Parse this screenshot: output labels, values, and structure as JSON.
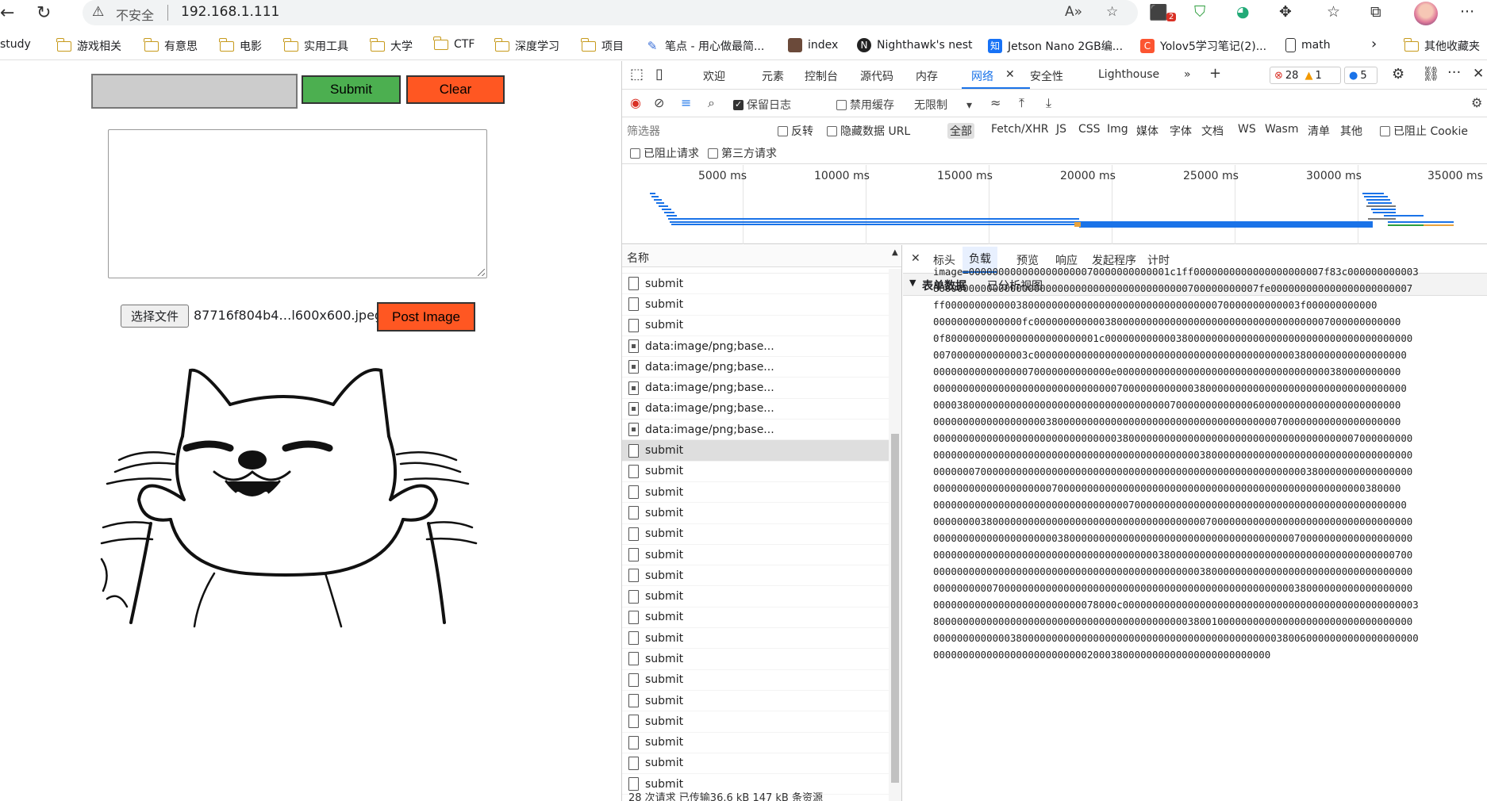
{
  "browser": {
    "not_secure": "不安全",
    "url": "192.168.1.111",
    "ext_badge": "2"
  },
  "bookmarks": [
    {
      "label": "study",
      "icon": "folder-icon"
    },
    {
      "label": "游戏相关",
      "icon": "folder-icon"
    },
    {
      "label": "有意思",
      "icon": "folder-icon"
    },
    {
      "label": "电影",
      "icon": "folder-icon"
    },
    {
      "label": "实用工具",
      "icon": "folder-icon"
    },
    {
      "label": "大学",
      "icon": "folder-icon"
    },
    {
      "label": "CTF",
      "icon": "folder-icon"
    },
    {
      "label": "深度学习",
      "icon": "folder-icon"
    },
    {
      "label": "项目",
      "icon": "folder-icon"
    },
    {
      "label": "笔点 - 用心做最简...",
      "icon": "pen-icon"
    },
    {
      "label": "index",
      "icon": "image-icon"
    },
    {
      "label": "Nighthawk's nest",
      "icon": "n-logo-icon"
    },
    {
      "label": "Jetson Nano 2GB编...",
      "icon": "zhihu-icon"
    },
    {
      "label": "Yolov5学习笔记(2)...",
      "icon": "csdn-icon"
    },
    {
      "label": "math",
      "icon": "page-icon"
    }
  ],
  "bookmarks_other": "其他收藏夹",
  "page": {
    "submit_label": "Submit",
    "clear_label": "Clear",
    "choose_file_label": "选择文件",
    "file_name": "87716f804b4…l600x600.jpeg",
    "post_image_label": "Post Image"
  },
  "devtools": {
    "tabs": [
      "欢迎",
      "元素",
      "控制台",
      "源代码",
      "内存",
      "网络",
      "安全性",
      "Lighthouse"
    ],
    "active_tab": "网络",
    "error_count": "28",
    "warning_count": "1",
    "message_count": "5",
    "preserve_log": "保留日志",
    "disable_cache": "禁用缓存",
    "throttle": "无限制",
    "filter_placeholder": "筛选器",
    "invert": "反转",
    "hide_data_urls": "隐藏数据 URL",
    "filter_types": [
      "全部",
      "Fetch/XHR",
      "JS",
      "CSS",
      "Img",
      "媒体",
      "字体",
      "文档",
      "WS",
      "Wasm",
      "清单",
      "其他"
    ],
    "blocked_cookies": "已阻止 Cookie",
    "blocked_requests": "已阻止请求",
    "third_party": "第三方请求",
    "timeline_ticks": [
      "5000 ms",
      "10000 ms",
      "15000 ms",
      "20000 ms",
      "25000 ms",
      "30000 ms",
      "35000 ms"
    ],
    "name_header": "名称",
    "requests": [
      {
        "name": "submit",
        "type": "doc"
      },
      {
        "name": "submit",
        "type": "doc"
      },
      {
        "name": "submit",
        "type": "doc"
      },
      {
        "name": "data:image/png;base...",
        "type": "img"
      },
      {
        "name": "data:image/png;base...",
        "type": "img"
      },
      {
        "name": "data:image/png;base...",
        "type": "img"
      },
      {
        "name": "data:image/png;base...",
        "type": "img"
      },
      {
        "name": "data:image/png;base...",
        "type": "img"
      },
      {
        "name": "submit",
        "type": "doc",
        "selected": true
      },
      {
        "name": "submit",
        "type": "doc"
      },
      {
        "name": "submit",
        "type": "doc"
      },
      {
        "name": "submit",
        "type": "doc"
      },
      {
        "name": "submit",
        "type": "doc"
      },
      {
        "name": "submit",
        "type": "doc"
      },
      {
        "name": "submit",
        "type": "doc"
      },
      {
        "name": "submit",
        "type": "doc"
      },
      {
        "name": "submit",
        "type": "doc"
      },
      {
        "name": "submit",
        "type": "doc"
      },
      {
        "name": "submit",
        "type": "doc"
      },
      {
        "name": "submit",
        "type": "doc"
      },
      {
        "name": "submit",
        "type": "doc"
      },
      {
        "name": "submit",
        "type": "doc"
      },
      {
        "name": "submit",
        "type": "doc"
      },
      {
        "name": "submit",
        "type": "doc"
      },
      {
        "name": "submit",
        "type": "doc"
      }
    ],
    "detail_tabs": [
      "标头",
      "负载",
      "预览",
      "响应",
      "发起程序",
      "计时"
    ],
    "active_detail_tab": "负载",
    "form_data_label": "表单数据",
    "parsed_view": "已分析视图",
    "payload_lines": [
      "image=0000000000000000000070000000000001c1ff0000000000000000000007f83c000000000003",
      "8000000000000000000000000000000000000000000700000000007fe000000000000000000000007",
      "ff000000000000380000000000000000000000000000000070000000000003f000000000000",
      "000000000000000fc00000000000038000000000000000000000000000000000007000000000000",
      "0f80000000000000000000000001c0000000000003800000000000000000000000000000000000000",
      "0070000000000003c000000000000000000000000000000000000000000003800000000000000000",
      "000000000000000070000000000000e000000000000000000000000000000000000380000000000",
      "00000000000000000000000000000007000000000000380000000000000000000000000000000000",
      "0000380000000000000000000000000000000000700000000000006000000000000000000000000",
      "0000000000000000000380000000000000000000000000000000000000700000000000000000000",
      "000000000000000000000000000000038000000000000000000000000000000000000007000000000",
      "000000000000000000000000000000000000000000000380000000000000000000000000000000000",
      "000000070000000000000000000000000000000000000000000000000000000380000000000000000",
      "0000000000000000000070000000000000000000000000000000000000000000000000000380000",
      "00000000000000000000000000000000070000000000000000000000000000000000000000000000",
      "000000003800000000000000000000000000000000000070000000000000000000000000000000000",
      "000000000000000000000380000000000000000000000000000000000000070000000000000000000",
      "000000000000000000000000000000000000003800000000000000000000000000000000000000700",
      "000000000000000000000000000000000000000000000380000000000000000000000000000000000",
      "000000000070000000000000000000000000000000000000000000000000038000000000000000000",
      "0000000000000000000000000078000c00000000000000000000000000000000000000000000000003",
      "800000000000000000000000000000000000000000038001000000000000000000000000000000000",
      "0000000000000380000000000000000000000000000000000000000000380060000000000000000000",
      "000000000000000000000000002000380000000000000000000000000"
    ],
    "status_bar": "28 次请求  已传输36.6 kB  147 kB 条资源"
  }
}
